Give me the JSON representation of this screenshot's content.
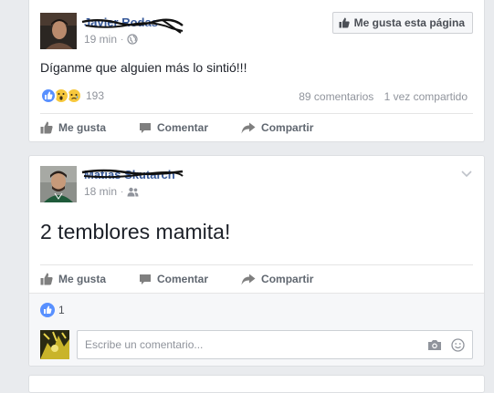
{
  "post1": {
    "author": "Javier Rodas",
    "time": "19 min",
    "privacy_icon": "globe-icon",
    "like_page_label": "Me gusta esta página",
    "text": "Díganme que alguien más lo sintió!!!",
    "reaction_count": "193",
    "comments": "89 comentarios",
    "shares": "1 vez compartido",
    "actions": {
      "like": "Me gusta",
      "comment": "Comentar",
      "share": "Compartir"
    }
  },
  "post2": {
    "author": "Matías Skutarch",
    "time": "18 min",
    "privacy_icon": "friends-icon",
    "text": "2 temblores mamita!",
    "actions": {
      "like": "Me gusta",
      "comment": "Comentar",
      "share": "Compartir"
    },
    "reaction_count": "1",
    "comment_placeholder": "Escribe un comentario..."
  },
  "colors": {
    "link": "#365899",
    "like_blue": "#5890ff",
    "wow_yellow": "#f7c83d",
    "page_bg": "#e9ebee"
  }
}
